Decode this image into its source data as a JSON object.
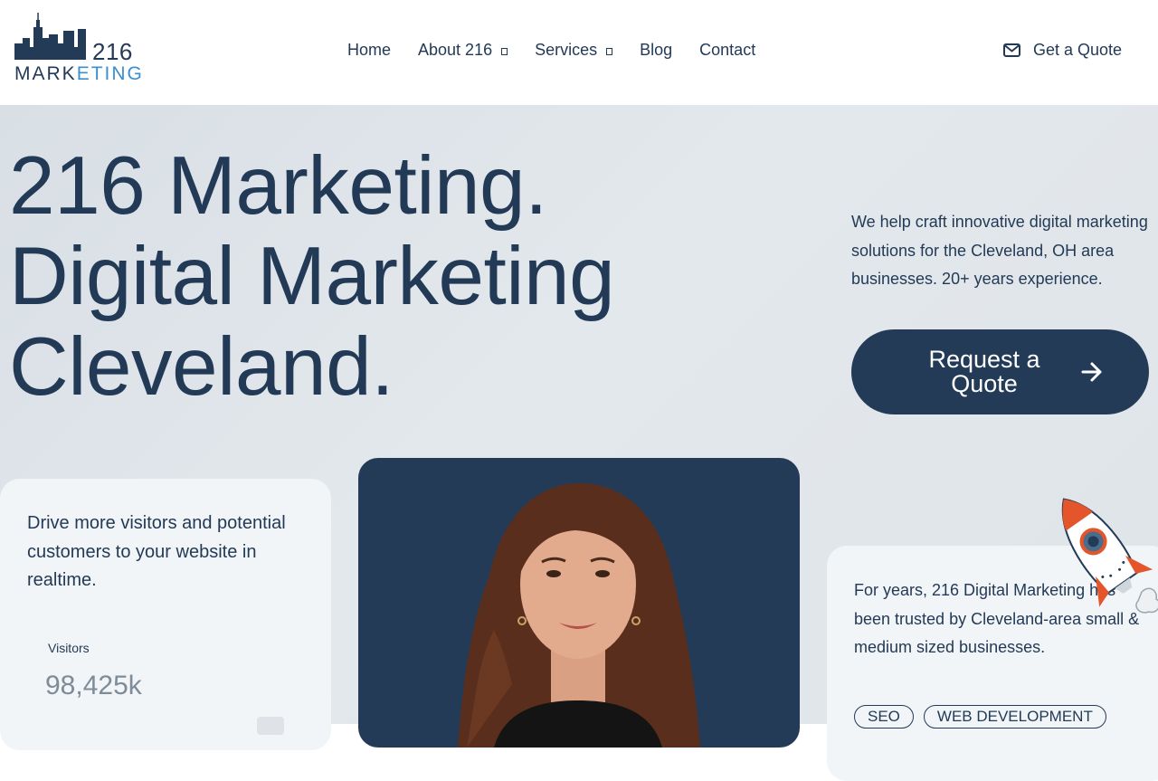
{
  "logo": {
    "number": "216",
    "word_a": "MARK",
    "word_b": "ETING"
  },
  "nav": {
    "items": [
      {
        "label": "Home",
        "dropdown": false
      },
      {
        "label": "About 216",
        "dropdown": true
      },
      {
        "label": "Services",
        "dropdown": true
      },
      {
        "label": "Blog",
        "dropdown": false
      },
      {
        "label": "Contact",
        "dropdown": false
      }
    ],
    "quote_label": "Get a Quote"
  },
  "hero": {
    "line1": "216 Marketing.",
    "line2": "Digital Marketing",
    "line3": "Cleveland.",
    "intro": "We help craft innovative digital marketing solutions for the Cleveland, OH area businesses. 20+ years experience.",
    "cta_label": "Request a Quote"
  },
  "card_left": {
    "text": "Drive more visitors and potential customers to your website in realtime.",
    "stat_label": "Visitors",
    "stat_value": "98,425k"
  },
  "card_right": {
    "text": "For years, 216 Digital Marketing has been trusted by Cleveland-area small & medium sized businesses.",
    "tags": [
      "SEO",
      "WEB DEVELOPMENT"
    ]
  },
  "colors": {
    "brand_navy": "#243b58",
    "accent_blue": "#3b8fd1",
    "rocket_red": "#e4552b"
  }
}
